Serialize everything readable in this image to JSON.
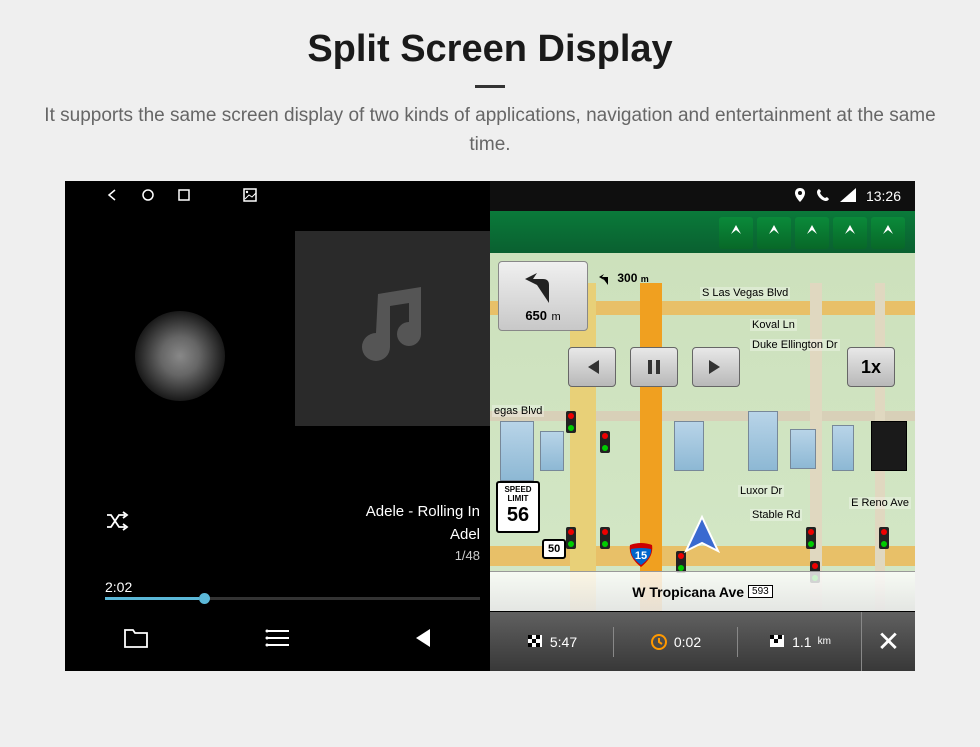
{
  "header": {
    "title": "Split Screen Display",
    "subtitle": "It supports the same screen display of two kinds of applications, navigation and entertainment at the same time."
  },
  "status": {
    "time": "13:26"
  },
  "music": {
    "track_title": "Adele - Rolling In",
    "track_artist": "Adel",
    "track_index": "1/48",
    "elapsed": "2:02"
  },
  "nav": {
    "turn_distance": "650",
    "turn_unit": "m",
    "next_dist": "300",
    "next_unit": "m",
    "speed_limit_label": "SPEED LIMIT",
    "speed_limit_value": "56",
    "playback_speed": "1x",
    "route_shield_50": "50",
    "interstate": "15",
    "current_road": "W Tropicana Ave",
    "current_road_num": "593",
    "roads": {
      "vegas_blvd": "S Las Vegas Blvd",
      "koval": "Koval Ln",
      "duke": "Duke Ellington Dr",
      "luxor": "Luxor Dr",
      "stable": "Stable Rd",
      "reno": "E Reno Ave",
      "vegas_blvd_partial": "egas Blvd"
    },
    "trip": {
      "eta": "5:47",
      "time": "0:02",
      "distance": "1.1",
      "distance_unit": "km"
    }
  }
}
